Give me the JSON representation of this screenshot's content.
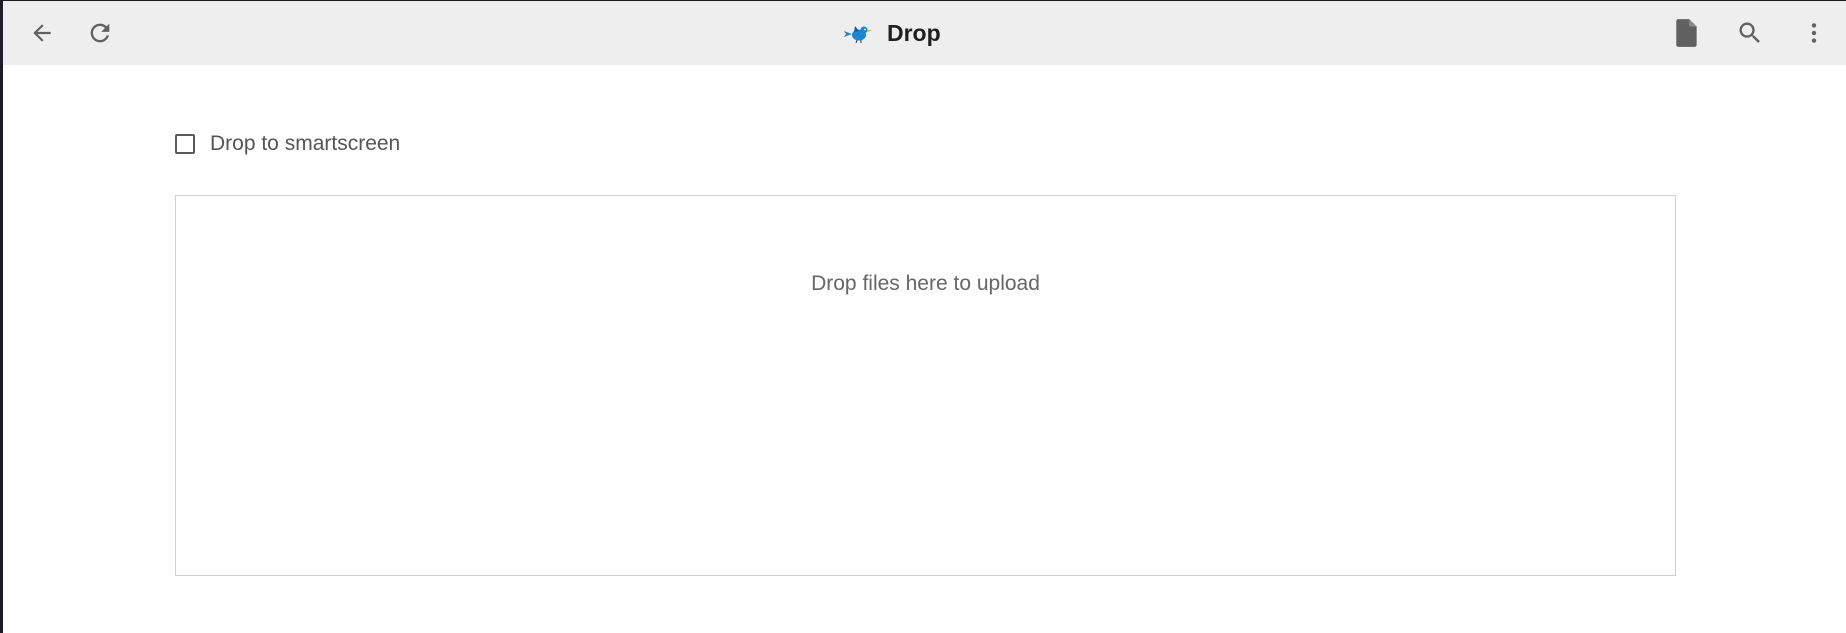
{
  "app": {
    "title": "Drop"
  },
  "toolbar": {
    "left_icons": [
      "arrow-left-icon",
      "refresh-icon"
    ],
    "right_icons": [
      "file-icon",
      "search-icon",
      "more-vert-icon"
    ],
    "logo_icon": "bird-logo-icon"
  },
  "content": {
    "checkbox": {
      "label": "Drop to smartscreen",
      "checked": false
    },
    "dropzone": {
      "message": "Drop files here to upload"
    }
  },
  "colors": {
    "toolbar_bg": "#eeeeee",
    "logo_blue": "#1a87d6",
    "icon_gray": "#616161",
    "text_gray": "#555555",
    "dropzone_border": "#cfcfcf"
  }
}
